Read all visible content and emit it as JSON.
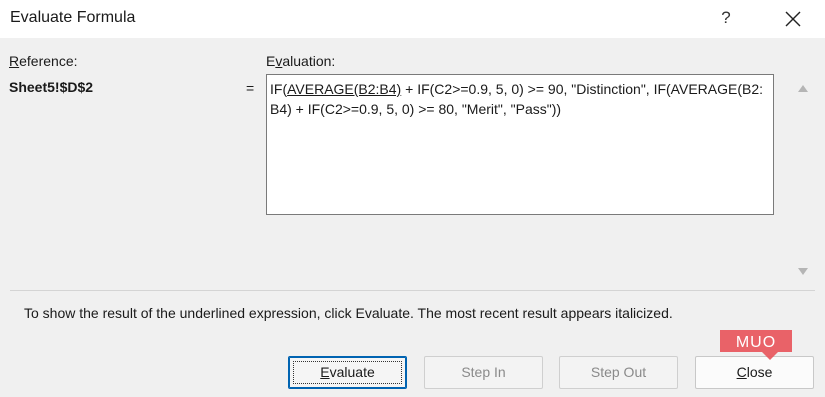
{
  "window": {
    "title": "Evaluate Formula",
    "help_glyph": "?"
  },
  "reference": {
    "label_first": "R",
    "label_rest": "eference:",
    "value": "Sheet5!$D$2",
    "equals": "="
  },
  "evaluation": {
    "label_first": "E",
    "label_u": "v",
    "label_rest": "aluation:",
    "prefix": "IF(",
    "underlined": "AVERAGE(B2:B4)",
    "rest": " + IF(C2>=0.9, 5, 0) >= 90, \"Distinction\", IF(AVERAGE(B2:B4) + IF(C2>=0.9, 5, 0) >= 80, \"Merit\", \"Pass\"))"
  },
  "hint": "To show the result of the underlined expression, click Evaluate.  The most recent result appears italicized.",
  "buttons": {
    "evaluate_u": "E",
    "evaluate_rest": "valuate",
    "step_in": "Step In",
    "step_out": "Step Out",
    "close_u": "C",
    "close_rest": "lose"
  },
  "watermark": "MUO",
  "colors": {
    "watermark_red": "#e8565c",
    "focus_blue": "#0063b1"
  }
}
